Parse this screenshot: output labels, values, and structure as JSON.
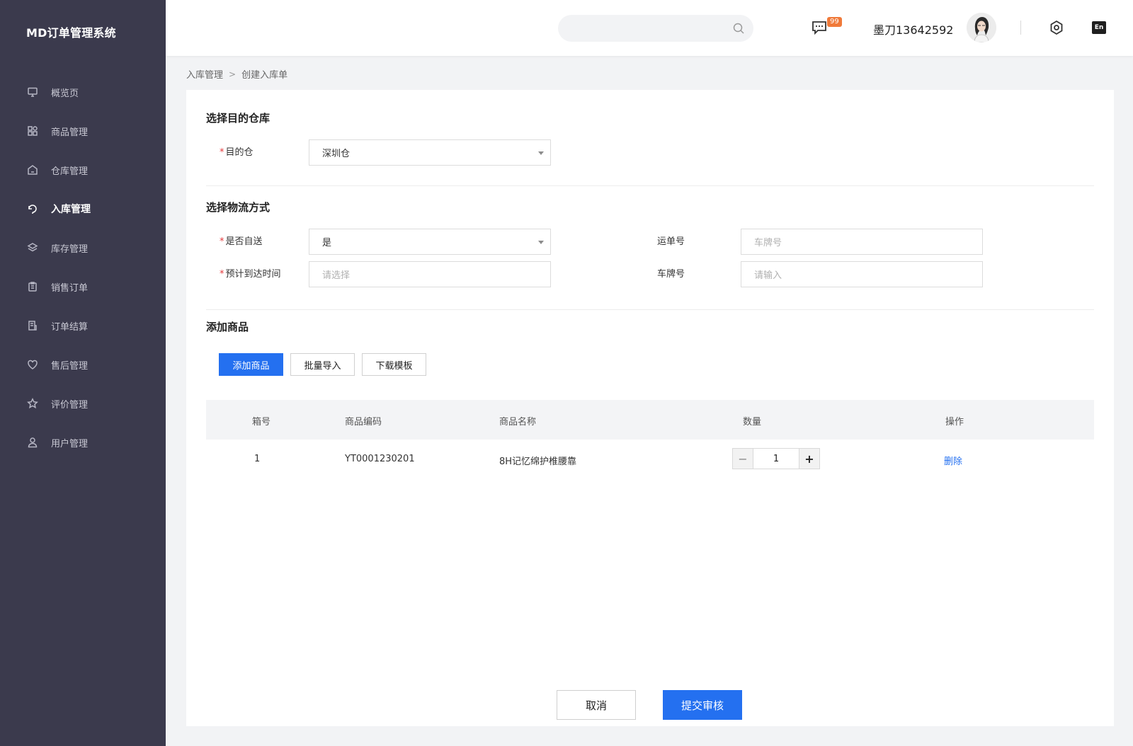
{
  "app": {
    "title": "MD订单管理系统"
  },
  "sidebar": {
    "items": [
      {
        "label": "概览页",
        "icon": "monitor-icon"
      },
      {
        "label": "商品管理",
        "icon": "grid-icon"
      },
      {
        "label": "仓库管理",
        "icon": "warehouse-icon"
      },
      {
        "label": "入库管理",
        "icon": "inbound-icon",
        "active": true
      },
      {
        "label": "库存管理",
        "icon": "layers-icon"
      },
      {
        "label": "销售订单",
        "icon": "clipboard-icon"
      },
      {
        "label": "订单结算",
        "icon": "receipt-icon"
      },
      {
        "label": "售后管理",
        "icon": "heart-icon"
      },
      {
        "label": "评价管理",
        "icon": "star-icon"
      },
      {
        "label": "用户管理",
        "icon": "user-icon"
      }
    ]
  },
  "header": {
    "search_placeholder": "",
    "message_badge": "99",
    "username": "墨刀13642592",
    "lang": "En"
  },
  "breadcrumb": {
    "parent": "入库管理",
    "separator": ">",
    "current": "创建入库单"
  },
  "section_warehouse": {
    "title": "选择目的仓库",
    "dest_label": "目的仓",
    "dest_value": "深圳仓"
  },
  "section_logistics": {
    "title": "选择物流方式",
    "self_delivery_label": "是否自送",
    "self_delivery_value": "是",
    "eta_label": "预计到达时间",
    "eta_placeholder": "请选择",
    "waybill_label": "运单号",
    "waybill_placeholder": "车牌号",
    "plate_label": "车牌号",
    "plate_placeholder": "请输入"
  },
  "section_goods": {
    "title": "添加商品",
    "add_button": "添加商品",
    "import_button": "批量导入",
    "template_button": "下载模板",
    "columns": [
      "箱号",
      "商品编码",
      "商品名称",
      "数量",
      "操作"
    ],
    "rows": [
      {
        "box": "1",
        "code": "YT0001230201",
        "name": "8H记忆绵护椎腰靠",
        "qty": "1",
        "action": "删除"
      }
    ]
  },
  "footer": {
    "cancel": "取消",
    "submit": "提交审核"
  },
  "colors": {
    "sidebar_bg": "#3b3a4d",
    "primary": "#2470f0",
    "badge": "#f07a3a",
    "required": "#e4393c"
  }
}
